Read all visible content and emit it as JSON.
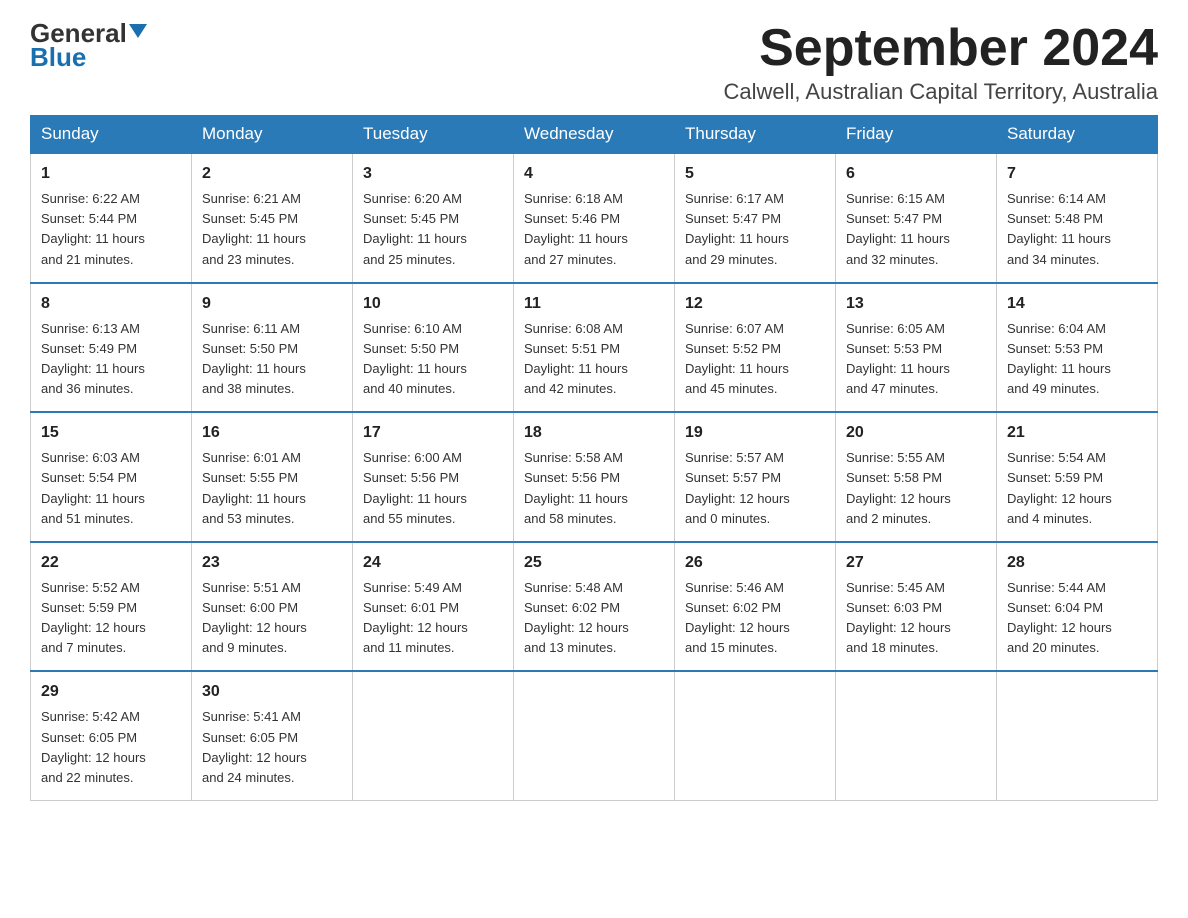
{
  "logo": {
    "general": "General",
    "triangle": "▲",
    "blue": "Blue"
  },
  "title": "September 2024",
  "subtitle": "Calwell, Australian Capital Territory, Australia",
  "days_of_week": [
    "Sunday",
    "Monday",
    "Tuesday",
    "Wednesday",
    "Thursday",
    "Friday",
    "Saturday"
  ],
  "weeks": [
    [
      {
        "num": "1",
        "sunrise": "6:22 AM",
        "sunset": "5:44 PM",
        "daylight": "11 hours and 21 minutes."
      },
      {
        "num": "2",
        "sunrise": "6:21 AM",
        "sunset": "5:45 PM",
        "daylight": "11 hours and 23 minutes."
      },
      {
        "num": "3",
        "sunrise": "6:20 AM",
        "sunset": "5:45 PM",
        "daylight": "11 hours and 25 minutes."
      },
      {
        "num": "4",
        "sunrise": "6:18 AM",
        "sunset": "5:46 PM",
        "daylight": "11 hours and 27 minutes."
      },
      {
        "num": "5",
        "sunrise": "6:17 AM",
        "sunset": "5:47 PM",
        "daylight": "11 hours and 29 minutes."
      },
      {
        "num": "6",
        "sunrise": "6:15 AM",
        "sunset": "5:47 PM",
        "daylight": "11 hours and 32 minutes."
      },
      {
        "num": "7",
        "sunrise": "6:14 AM",
        "sunset": "5:48 PM",
        "daylight": "11 hours and 34 minutes."
      }
    ],
    [
      {
        "num": "8",
        "sunrise": "6:13 AM",
        "sunset": "5:49 PM",
        "daylight": "11 hours and 36 minutes."
      },
      {
        "num": "9",
        "sunrise": "6:11 AM",
        "sunset": "5:50 PM",
        "daylight": "11 hours and 38 minutes."
      },
      {
        "num": "10",
        "sunrise": "6:10 AM",
        "sunset": "5:50 PM",
        "daylight": "11 hours and 40 minutes."
      },
      {
        "num": "11",
        "sunrise": "6:08 AM",
        "sunset": "5:51 PM",
        "daylight": "11 hours and 42 minutes."
      },
      {
        "num": "12",
        "sunrise": "6:07 AM",
        "sunset": "5:52 PM",
        "daylight": "11 hours and 45 minutes."
      },
      {
        "num": "13",
        "sunrise": "6:05 AM",
        "sunset": "5:53 PM",
        "daylight": "11 hours and 47 minutes."
      },
      {
        "num": "14",
        "sunrise": "6:04 AM",
        "sunset": "5:53 PM",
        "daylight": "11 hours and 49 minutes."
      }
    ],
    [
      {
        "num": "15",
        "sunrise": "6:03 AM",
        "sunset": "5:54 PM",
        "daylight": "11 hours and 51 minutes."
      },
      {
        "num": "16",
        "sunrise": "6:01 AM",
        "sunset": "5:55 PM",
        "daylight": "11 hours and 53 minutes."
      },
      {
        "num": "17",
        "sunrise": "6:00 AM",
        "sunset": "5:56 PM",
        "daylight": "11 hours and 55 minutes."
      },
      {
        "num": "18",
        "sunrise": "5:58 AM",
        "sunset": "5:56 PM",
        "daylight": "11 hours and 58 minutes."
      },
      {
        "num": "19",
        "sunrise": "5:57 AM",
        "sunset": "5:57 PM",
        "daylight": "12 hours and 0 minutes."
      },
      {
        "num": "20",
        "sunrise": "5:55 AM",
        "sunset": "5:58 PM",
        "daylight": "12 hours and 2 minutes."
      },
      {
        "num": "21",
        "sunrise": "5:54 AM",
        "sunset": "5:59 PM",
        "daylight": "12 hours and 4 minutes."
      }
    ],
    [
      {
        "num": "22",
        "sunrise": "5:52 AM",
        "sunset": "5:59 PM",
        "daylight": "12 hours and 7 minutes."
      },
      {
        "num": "23",
        "sunrise": "5:51 AM",
        "sunset": "6:00 PM",
        "daylight": "12 hours and 9 minutes."
      },
      {
        "num": "24",
        "sunrise": "5:49 AM",
        "sunset": "6:01 PM",
        "daylight": "12 hours and 11 minutes."
      },
      {
        "num": "25",
        "sunrise": "5:48 AM",
        "sunset": "6:02 PM",
        "daylight": "12 hours and 13 minutes."
      },
      {
        "num": "26",
        "sunrise": "5:46 AM",
        "sunset": "6:02 PM",
        "daylight": "12 hours and 15 minutes."
      },
      {
        "num": "27",
        "sunrise": "5:45 AM",
        "sunset": "6:03 PM",
        "daylight": "12 hours and 18 minutes."
      },
      {
        "num": "28",
        "sunrise": "5:44 AM",
        "sunset": "6:04 PM",
        "daylight": "12 hours and 20 minutes."
      }
    ],
    [
      {
        "num": "29",
        "sunrise": "5:42 AM",
        "sunset": "6:05 PM",
        "daylight": "12 hours and 22 minutes."
      },
      {
        "num": "30",
        "sunrise": "5:41 AM",
        "sunset": "6:05 PM",
        "daylight": "12 hours and 24 minutes."
      },
      null,
      null,
      null,
      null,
      null
    ]
  ],
  "labels": {
    "sunrise": "Sunrise:",
    "sunset": "Sunset:",
    "daylight": "Daylight:"
  }
}
